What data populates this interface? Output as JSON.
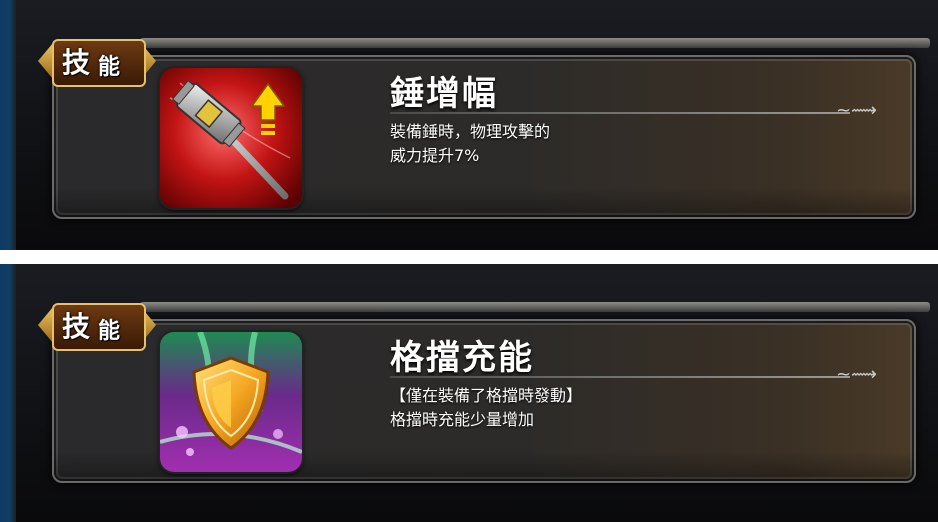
{
  "panels": [
    {
      "badge": {
        "char1": "技",
        "char2": "能"
      },
      "icon": "hammer-up-icon",
      "title": "錘增幅",
      "desc_lines": [
        "裝備錘時，物理攻擊的",
        "威力提升7%"
      ]
    },
    {
      "badge": {
        "char1": "技",
        "char2": "能"
      },
      "icon": "shield-charge-icon",
      "title": "格擋充能",
      "desc_lines": [
        "【僅在裝備了格擋時發動】",
        "格擋時充能少量增加"
      ]
    }
  ],
  "colors": {
    "accent": "#e8c067",
    "text": "#ffffff",
    "panel_bg": "#1a1c22"
  }
}
